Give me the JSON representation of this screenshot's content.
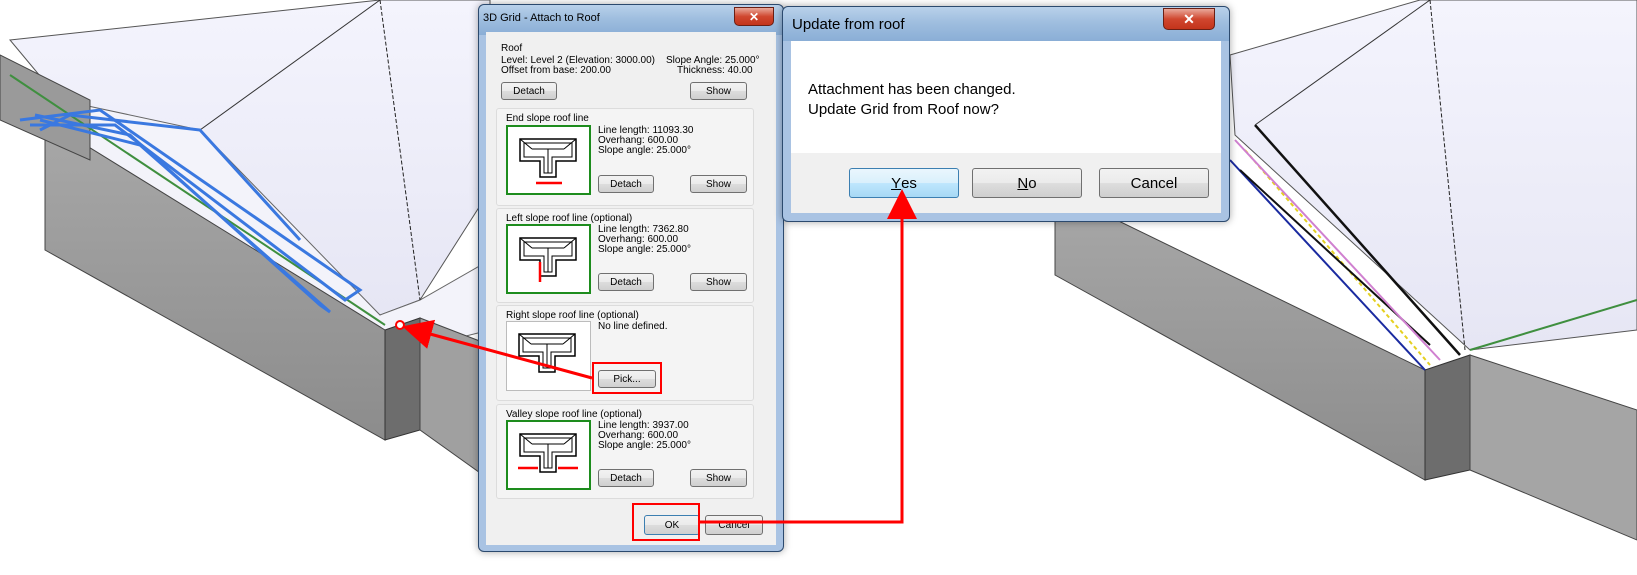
{
  "attach_dialog": {
    "title": "3D Grid - Attach to Roof",
    "roof": {
      "heading": "Roof",
      "level": "Level: Level 2  (Elevation: 3000.00)",
      "offset": "Offset from base: 200.00",
      "slope_angle": "Slope Angle: 25.000°",
      "thickness": "Thickness: 40.00",
      "detach_label": "Detach",
      "show_label": "Show"
    },
    "end_slope": {
      "heading": "End slope roof line",
      "line_length": "Line length: 11093.30",
      "overhang": "Overhang: 600.00",
      "slope_angle": "Slope angle: 25.000°",
      "detach_label": "Detach",
      "show_label": "Show"
    },
    "left_slope": {
      "heading": "Left slope roof line (optional)",
      "line_length": "Line length: 7362.80",
      "overhang": "Overhang: 600.00",
      "slope_angle": "Slope angle: 25.000°",
      "detach_label": "Detach",
      "show_label": "Show"
    },
    "right_slope": {
      "heading": "Right slope roof line (optional)",
      "status": "No line defined.",
      "pick_label": "Pick..."
    },
    "valley_slope": {
      "heading": "Valley slope roof line (optional)",
      "line_length": "Line length: 3937.00",
      "overhang": "Overhang: 600.00",
      "slope_angle": "Slope angle: 25.000°",
      "detach_label": "Detach",
      "show_label": "Show"
    },
    "ok_label": "OK",
    "cancel_label": "Cancel"
  },
  "update_dialog": {
    "title": "Update from roof",
    "message_line1": "Attachment has been changed.",
    "message_line2": "Update Grid from Roof now?",
    "yes_mnemonic": "Y",
    "yes_rest": "es",
    "no_mnemonic": "N",
    "no_rest": "o",
    "cancel_label": "Cancel"
  },
  "colors": {
    "annotation_red": "#ff0000",
    "selection_blue": "#3a78e0",
    "wall_grey": "#9a9a9a",
    "roof_lavender": "#eeeefa",
    "thumb_green_border": "#1d8c1d"
  }
}
